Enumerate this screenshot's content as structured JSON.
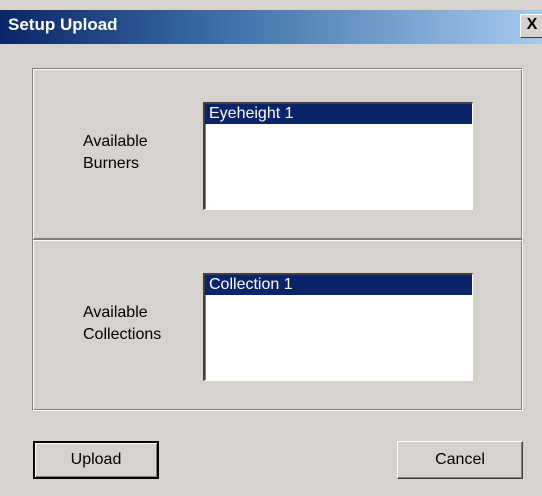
{
  "window": {
    "title": "Setup Upload",
    "close_label": "X"
  },
  "burners": {
    "label_line1": "Available",
    "label_line2": "Burners",
    "items": [
      "Eyeheight 1"
    ],
    "selected": "Eyeheight 1"
  },
  "collections": {
    "label_line1": "Available",
    "label_line2": "Collections",
    "items": [
      "Collection 1"
    ],
    "selected": "Collection 1"
  },
  "buttons": {
    "upload_label": "Upload",
    "cancel_label": "Cancel"
  },
  "colors": {
    "face": "#d6d3ce",
    "selection": "#0a246a",
    "titlebar_start": "#0a246a",
    "titlebar_end": "#a6caf0"
  }
}
